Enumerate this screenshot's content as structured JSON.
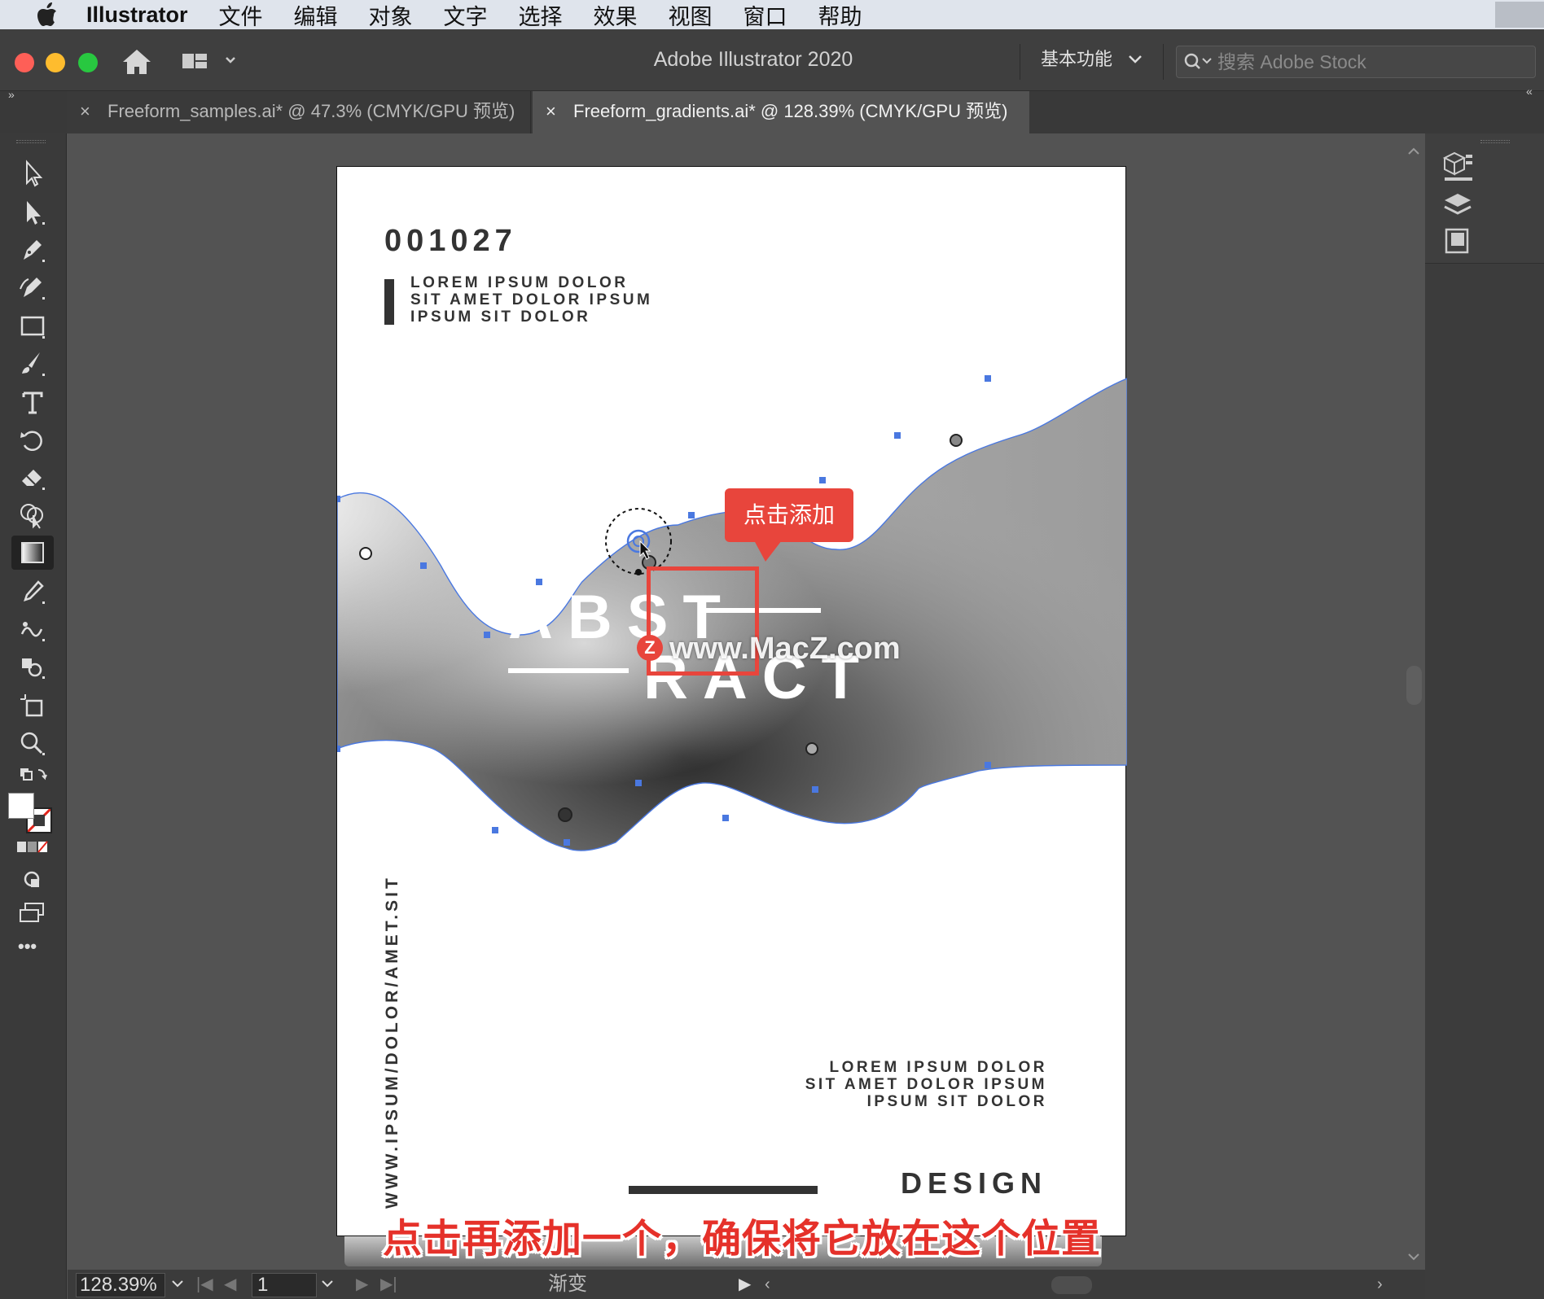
{
  "menubar": {
    "app_name": "Illustrator",
    "items": [
      "文件",
      "编辑",
      "对象",
      "文字",
      "选择",
      "效果",
      "视图",
      "窗口",
      "帮助"
    ]
  },
  "titlebar": {
    "window_title": "Adobe Illustrator 2020",
    "workspace_label": "基本功能",
    "stock_search_placeholder": "搜索 Adobe Stock"
  },
  "tabs": [
    {
      "close": "×",
      "label": "Freeform_samples.ai* @ 47.3% (CMYK/GPU 预览)",
      "active": false
    },
    {
      "close": "×",
      "label": "Freeform_gradients.ai* @ 128.39% (CMYK/GPU 预览)",
      "active": true
    }
  ],
  "panel_toggles": {
    "left": "»",
    "right": "«"
  },
  "toolbar": {
    "tools": [
      "selection-tool",
      "direct-selection-tool",
      "pen-tool",
      "curvature-tool",
      "rectangle-tool",
      "paintbrush-tool",
      "type-tool",
      "rotate-tool",
      "eraser-tool",
      "shape-builder-tool",
      "gradient-tool",
      "eyedropper-tool",
      "blend-tool",
      "symbol-sprayer-tool",
      "artboard-tool",
      "zoom-tool"
    ],
    "active_tool": "gradient-tool",
    "more_label": "•••"
  },
  "artboard": {
    "number": "001027",
    "paragraph_top": [
      "LOREM IPSUM DOLOR",
      "SIT AMET DOLOR IPSUM",
      "IPSUM SIT DOLOR"
    ],
    "title_line1": "ABST",
    "title_line2": "RACT",
    "vertical_url": "WWW.IPSUM/DOLOR/AMET.SIT",
    "paragraph_bottom": [
      "LOREM IPSUM DOLOR",
      "SIT AMET DOLOR IPSUM",
      "IPSUM SIT DOLOR"
    ],
    "design_label": "DESIGN"
  },
  "annotations": {
    "callout": "点击添加",
    "watermark": "www.MacZ.com",
    "watermark_badge": "Z",
    "subtitle": "点击再添加一个，确保将它放在这个位置"
  },
  "statusbar": {
    "zoom": "128.39%",
    "page": "1",
    "status_text": "渐变"
  },
  "colors": {
    "accent_red": "#e8453c",
    "selection_blue": "#4a78e0",
    "canvas_bg": "#535353"
  }
}
